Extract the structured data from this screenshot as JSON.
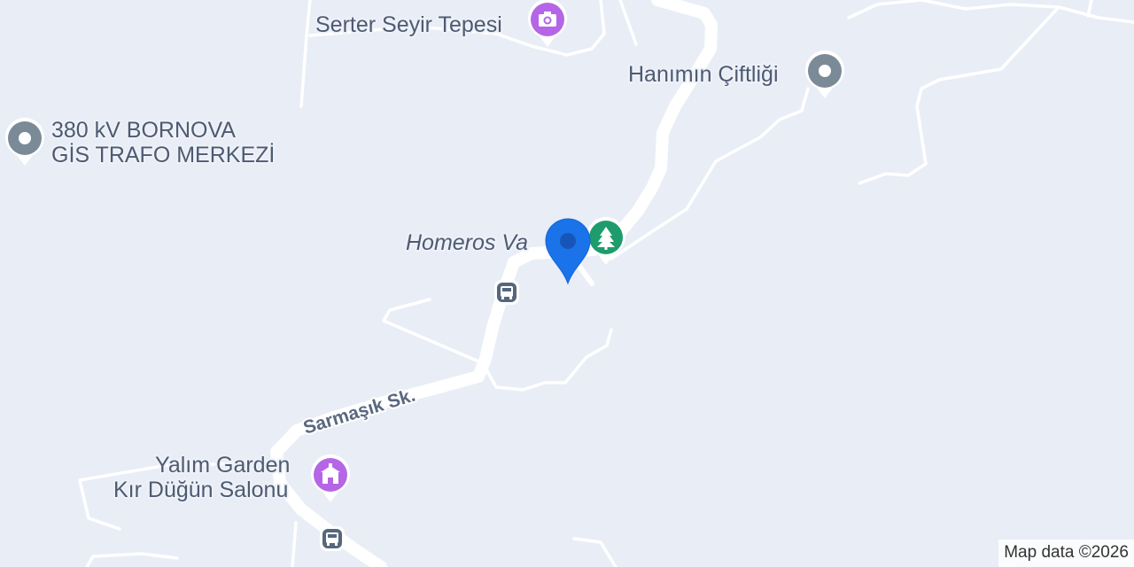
{
  "map": {
    "places": [
      {
        "key": "serter",
        "name": "Serter Seyir Tepesi",
        "icon": "camera-icon",
        "color": "#b566e6"
      },
      {
        "key": "hanimin",
        "name": "Hanımın Çiftliği",
        "icon": "place-dot-icon",
        "color": "#7b8a97"
      },
      {
        "key": "bornova",
        "name_line1": "380 kV BORNOVA",
        "name_line2": "GİS TRAFO MERKEZİ",
        "icon": "place-dot-icon",
        "color": "#7b8a97"
      },
      {
        "key": "homeros",
        "name": "Homeros Va",
        "icon": "tree-icon",
        "color": "#1e9c6e"
      },
      {
        "key": "yalim",
        "name_line1": "Yalım Garden",
        "name_line2": "Kır Düğün Salonu",
        "icon": "venue-icon",
        "color": "#b566e6"
      }
    ],
    "roads": [
      {
        "key": "sarmasik",
        "name": "Sarmaşık Sk."
      }
    ],
    "transit": [
      {
        "key": "bus-stop-1",
        "icon": "bus-icon"
      },
      {
        "key": "bus-stop-2",
        "icon": "bus-icon"
      }
    ],
    "selected_marker": {
      "icon": "location-pin-icon",
      "color": "#1a73e8"
    },
    "attribution": "Map data ©2026"
  }
}
